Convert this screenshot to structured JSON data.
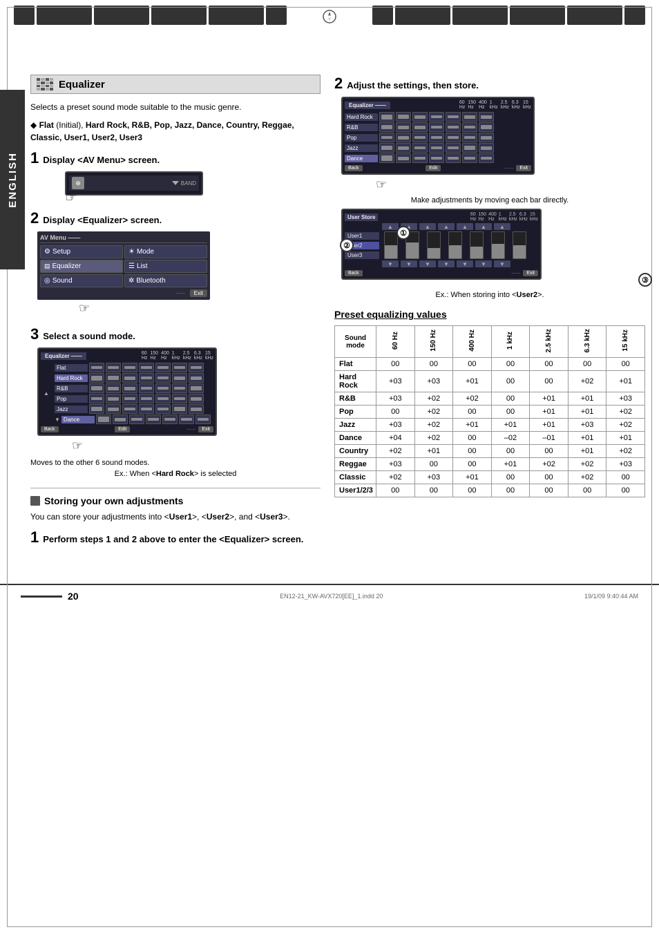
{
  "page": {
    "number": "20",
    "footer_file": "EN12-21_KW-AVX720[EE]_1.indd  20",
    "footer_date": "19/1/09  9:40:44 AM",
    "side_label": "ENGLISH"
  },
  "section_title": "Equalizer",
  "intro_text": "Selects a preset sound mode suitable to the music genre.",
  "preset_modes": "Flat (Initial), Hard Rock, R&B, Pop, Jazz, Dance, Country, Reggae, Classic, User1, User2, User3",
  "steps": {
    "step1_left": {
      "num": "1",
      "title": "Display <AV Menu> screen."
    },
    "step2_left": {
      "num": "2",
      "title": "Display <Equalizer> screen."
    },
    "step3_left": {
      "num": "3",
      "title": "Select a sound mode."
    },
    "step1_right": {
      "num": "1",
      "title": "Perform steps 1 and 2 above to enter the <Equalizer> screen."
    },
    "step2_right": {
      "num": "2",
      "title": "Adjust the settings, then store."
    }
  },
  "sub_heading": "Storing your own adjustments",
  "sub_heading_text": "You can store your adjustments into <User1>, <User2>, and <User3>.",
  "note1": "Moves to the other 6 sound modes.",
  "note2": "Ex.: When <Hard Rock> is selected",
  "note3": "Make adjustments by moving each bar directly.",
  "note4": "Ex.: When storing into <User2>.",
  "av_menu": {
    "title": "AV Menu",
    "items": [
      {
        "icon": "gear",
        "label": "Setup"
      },
      {
        "icon": "sun",
        "label": "Mode"
      },
      {
        "icon": "eq",
        "label": "Equalizer"
      },
      {
        "icon": "list",
        "label": "List"
      },
      {
        "icon": "sound",
        "label": "Sound"
      },
      {
        "icon": "bt",
        "label": "Bluetooth"
      }
    ],
    "exit": "Exit",
    "band": "BAND"
  },
  "eq_modes": [
    "Flat",
    "Hard Rock",
    "R&B",
    "Pop",
    "Jazz",
    "Dance"
  ],
  "eq_freqs": [
    "60 Hz",
    "150 Hz",
    "400 Hz",
    "1 kHz",
    "2.5 kHz",
    "6.3 kHz",
    "15 kHz"
  ],
  "eq_freqs_short": [
    "60\nHz",
    "150\nHz",
    "400\nHz",
    "1\nkHz",
    "2.5\nkHz",
    "6.3\nkHz",
    "15\nkHz"
  ],
  "buttons": {
    "back": "Back",
    "edit": "Edit",
    "exit": "Exit"
  },
  "user_store": {
    "title": "User Store",
    "labels": [
      "User1",
      "User2",
      "User3"
    ]
  },
  "preset_table": {
    "title": "Preset equalizing values",
    "headers": [
      "Sound\nmode",
      "60 Hz",
      "150 Hz",
      "400 Hz",
      "1 kHz",
      "2.5 kHz",
      "6.3 kHz",
      "15 kHz"
    ],
    "rows": [
      {
        "mode": "Flat",
        "vals": [
          "00",
          "00",
          "00",
          "00",
          "00",
          "00",
          "00"
        ]
      },
      {
        "mode": "Hard Rock",
        "vals": [
          "+03",
          "+03",
          "+01",
          "00",
          "00",
          "+02",
          "+01"
        ]
      },
      {
        "mode": "R&B",
        "vals": [
          "+03",
          "+02",
          "+02",
          "00",
          "+01",
          "+01",
          "+03"
        ]
      },
      {
        "mode": "Pop",
        "vals": [
          "00",
          "+02",
          "00",
          "00",
          "+01",
          "+01",
          "+02"
        ]
      },
      {
        "mode": "Jazz",
        "vals": [
          "+03",
          "+02",
          "+01",
          "+01",
          "+01",
          "+03",
          "+02"
        ]
      },
      {
        "mode": "Dance",
        "vals": [
          "+04",
          "+02",
          "00",
          "–02",
          "–01",
          "+01",
          "+01"
        ]
      },
      {
        "mode": "Country",
        "vals": [
          "+02",
          "+01",
          "00",
          "00",
          "00",
          "+01",
          "+02"
        ]
      },
      {
        "mode": "Reggae",
        "vals": [
          "+03",
          "00",
          "00",
          "+01",
          "+02",
          "+02",
          "+03"
        ]
      },
      {
        "mode": "Classic",
        "vals": [
          "+02",
          "+03",
          "+01",
          "00",
          "00",
          "+02",
          "00"
        ]
      },
      {
        "mode": "User1/2/3",
        "vals": [
          "00",
          "00",
          "00",
          "00",
          "00",
          "00",
          "00"
        ]
      }
    ]
  }
}
